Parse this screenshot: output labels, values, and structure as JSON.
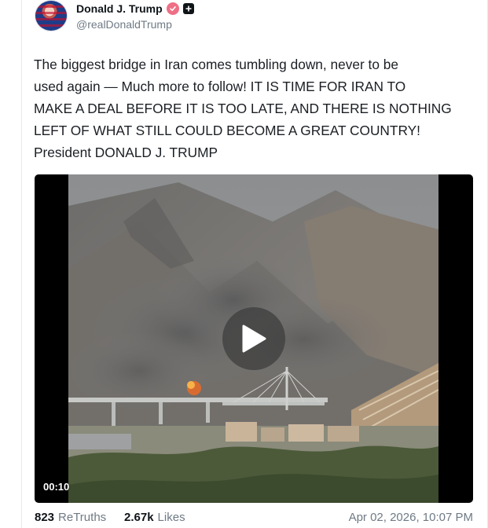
{
  "author": {
    "display_name": "Donald J. Trump",
    "handle": "@realDonaldTrump",
    "avatar_icon": "flag-portrait-avatar",
    "verified_icon": "verified-badge-icon",
    "verified_color": "#ee6f86"
  },
  "post": {
    "text": "The biggest bridge in Iran comes tumbling down, never to be\nused again — Much more to follow! IT IS TIME FOR IRAN TO\nMAKE A DEAL BEFORE IT IS TOO LATE, AND THERE IS NOTHING\nLEFT OF WHAT STILL COULD BECOME A GREAT COUNTRY!\nPresident DONALD J. TRUMP"
  },
  "video": {
    "duration": "00:10",
    "play_icon": "play-icon"
  },
  "stats": {
    "retruths_count": "823",
    "retruths_label": "ReTruths",
    "likes_count": "2.67k",
    "likes_label": "Likes",
    "date": "Apr 02, 2026, 10:07 PM"
  }
}
